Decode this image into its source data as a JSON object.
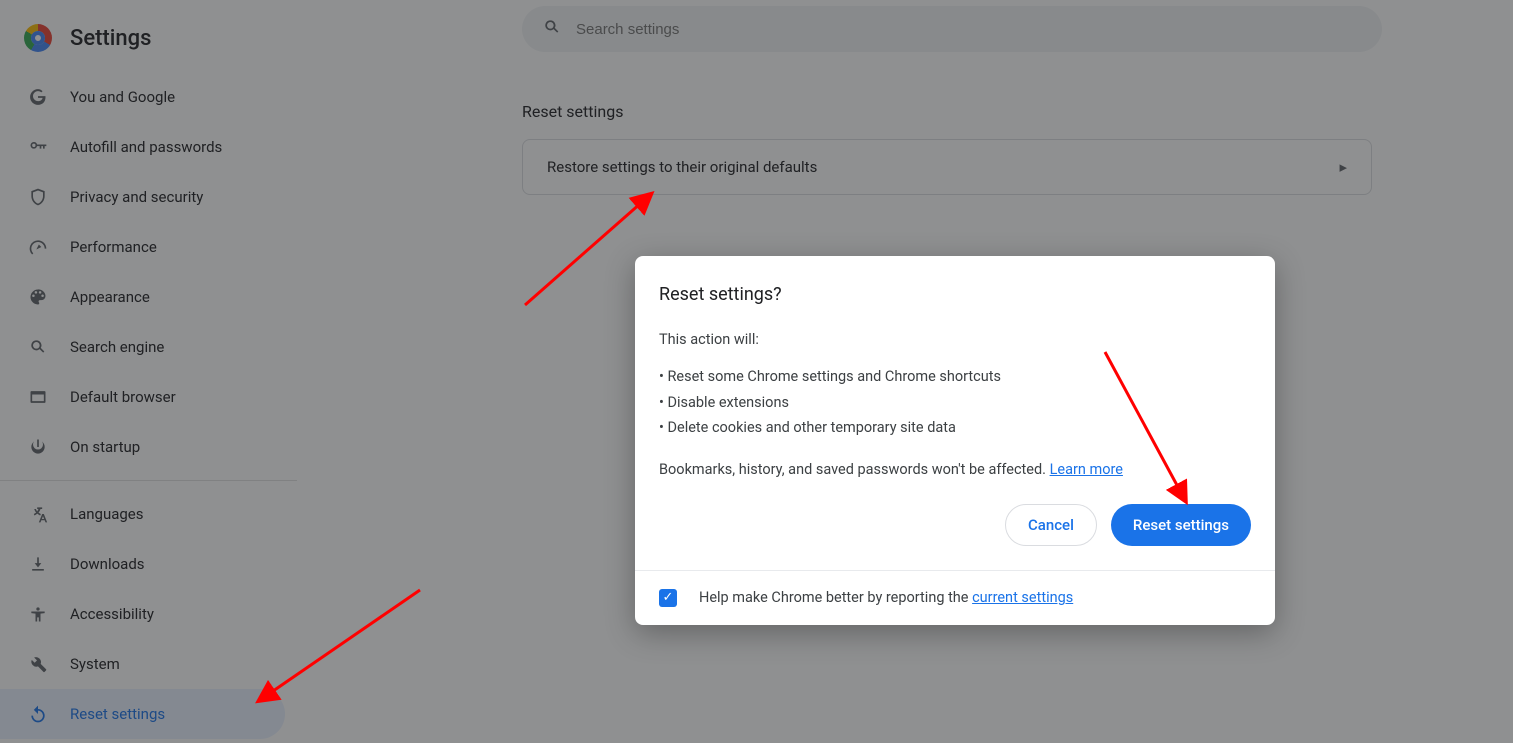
{
  "app_title": "Settings",
  "search": {
    "placeholder": "Search settings"
  },
  "sidebar": {
    "items": [
      {
        "label": "You and Google",
        "icon": "google"
      },
      {
        "label": "Autofill and passwords",
        "icon": "key"
      },
      {
        "label": "Privacy and security",
        "icon": "shield"
      },
      {
        "label": "Performance",
        "icon": "speedometer"
      },
      {
        "label": "Appearance",
        "icon": "palette"
      },
      {
        "label": "Search engine",
        "icon": "search"
      },
      {
        "label": "Default browser",
        "icon": "browser"
      },
      {
        "label": "On startup",
        "icon": "power"
      }
    ],
    "items2": [
      {
        "label": "Languages",
        "icon": "translate"
      },
      {
        "label": "Downloads",
        "icon": "download"
      },
      {
        "label": "Accessibility",
        "icon": "accessibility"
      },
      {
        "label": "System",
        "icon": "wrench"
      },
      {
        "label": "Reset settings",
        "icon": "reset",
        "active": true
      }
    ]
  },
  "main": {
    "section_title": "Reset settings",
    "restore_label": "Restore settings to their original defaults"
  },
  "dialog": {
    "title": "Reset settings?",
    "intro": "This action will:",
    "bullet1": "• Reset some Chrome settings and Chrome shortcuts",
    "bullet2": "• Disable extensions",
    "bullet3": "• Delete cookies and other temporary site data",
    "note_before": "Bookmarks, history, and saved passwords won't be affected.",
    "learn_more": "Learn more",
    "cancel": "Cancel",
    "confirm": "Reset settings",
    "footer_before": "Help make Chrome better by reporting the ",
    "footer_link": "current settings"
  }
}
